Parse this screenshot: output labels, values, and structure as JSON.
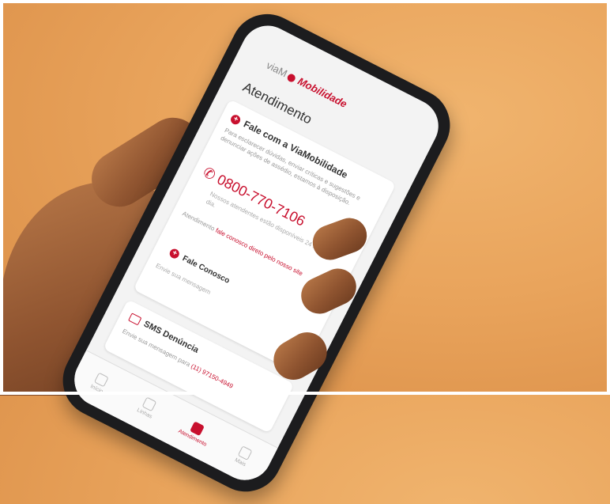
{
  "app": {
    "brand_prefix": "viaM",
    "brand_name": "Mobilidade",
    "page_title": "Atendimento"
  },
  "contact_card": {
    "title": "Fale com a ViaMobilidade",
    "description": "Para esclarecer dúvidas, enviar críticas e sugestões e denunciar ações de assédio, estamos à disposição.",
    "phone": "0800-770-7106",
    "phone_note": "Nossos atendentes estão disponíveis 24 horas por dia.",
    "extra_text": "Atendimento",
    "extra_link": "fale conosco direto pelo nosso site",
    "chat_label": "Fale Conosco",
    "chat_sub": "Envie sua mensagem"
  },
  "sms_card": {
    "title": "SMS Denúncia",
    "text": "Envie sua mensagem para",
    "number": "(11) 97150-4949"
  },
  "tabbar": [
    {
      "label": "Início",
      "active": false
    },
    {
      "label": "Linhas",
      "active": false
    },
    {
      "label": "Atendimento",
      "active": true
    },
    {
      "label": "Mais",
      "active": false
    }
  ]
}
